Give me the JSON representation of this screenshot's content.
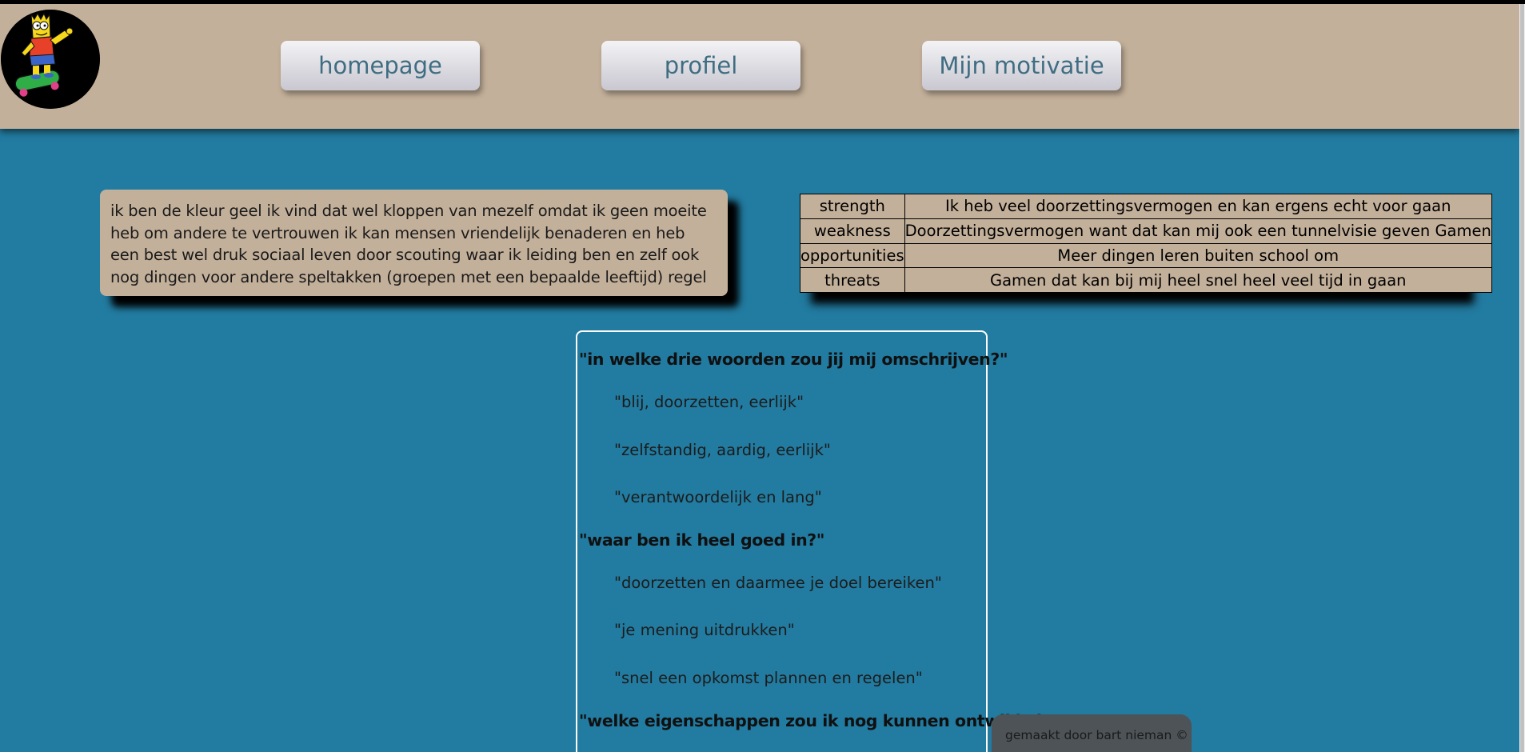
{
  "logo": {
    "icon": "bart-simpson-skateboard-icon"
  },
  "nav": {
    "homepage": "homepage",
    "profile": "profiel",
    "motivation": "Mijn motivatie"
  },
  "intro": {
    "text": "ik ben de kleur geel ik vind dat wel kloppen van mezelf omdat ik geen moeite heb om andere te vertrouwen ik kan mensen vriendelijk benaderen en heb een best wel druk sociaal leven door scouting waar ik leiding ben en zelf ook nog dingen voor andere speltakken (groepen met een bepaalde leeftijd) regel"
  },
  "swot": {
    "rows": [
      {
        "label": "strength",
        "value": "Ik heb veel doorzettingsvermogen en kan ergens echt voor gaan"
      },
      {
        "label": "weakness",
        "value": "Doorzettingsvermogen want dat kan mij ook een tunnelvisie geven Gamen"
      },
      {
        "label": "opportunities",
        "value": "Meer dingen leren buiten school om"
      },
      {
        "label": "threats",
        "value": "Gamen dat kan bij mij heel snel heel veel tijd in gaan"
      }
    ]
  },
  "quotes": {
    "q1": {
      "question": "\"in welke drie woorden zou jij mij omschrijven?\"",
      "answers": [
        "\"blij, doorzetten, eerlijk\"",
        "\"zelfstandig, aardig, eerlijk\"",
        "\"verantwoordelijk en lang\""
      ]
    },
    "q2": {
      "question": "\"waar ben ik heel goed in?\"",
      "answers": [
        "\"doorzetten en daarmee je doel bereiken\"",
        "\"je mening uitdrukken\"",
        "\"snel een opkomst plannen en regelen\""
      ]
    },
    "q3": {
      "question": "\"welke eigenschappen zou ik nog kunnen ontwikkelen\""
    }
  },
  "footer": {
    "credit": "gemaakt door bart nieman ©"
  },
  "colors": {
    "background": "#227ba0",
    "header": "#c3b09a",
    "nav_text": "#3f6d82",
    "footer_badge": "#4d5357"
  }
}
